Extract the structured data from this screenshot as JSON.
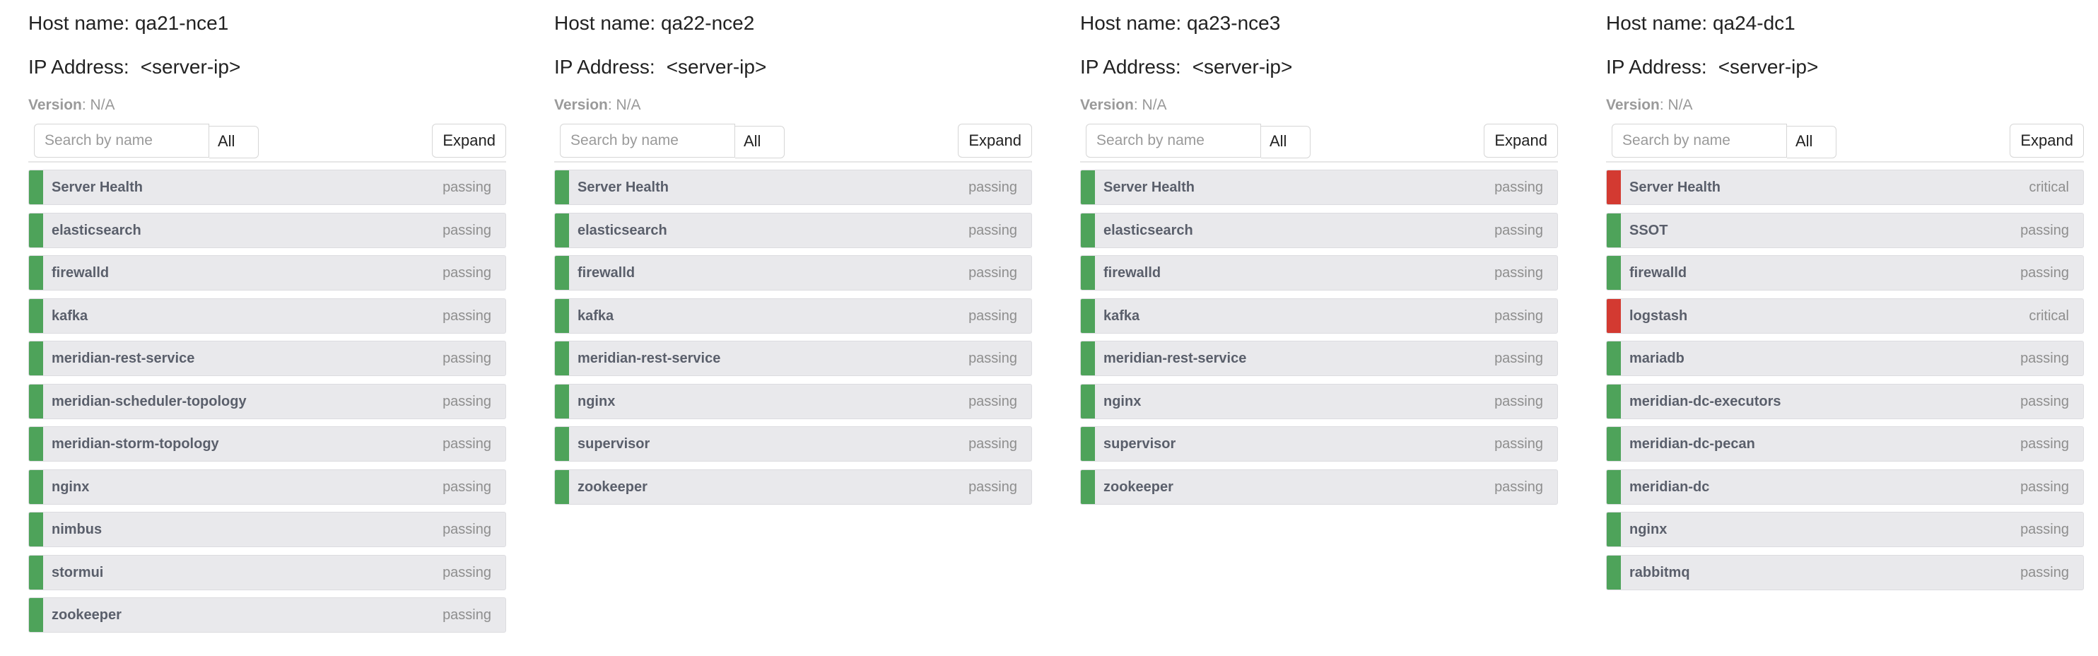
{
  "labels": {
    "host_name_prefix": "Host name:",
    "ip_prefix": "IP Address:",
    "version_prefix": "Version",
    "search_placeholder": "Search by name",
    "filter_value": "All",
    "expand_label": "Expand"
  },
  "colors": {
    "passing": "#4ea35a",
    "critical": "#d33a31"
  },
  "hosts": [
    {
      "name": "qa21-nce1",
      "ip": "<server-ip>",
      "version": ": N/A",
      "checks": [
        {
          "name": "Server Health",
          "status": "passing"
        },
        {
          "name": "elasticsearch",
          "status": "passing"
        },
        {
          "name": "firewalld",
          "status": "passing"
        },
        {
          "name": "kafka",
          "status": "passing"
        },
        {
          "name": "meridian-rest-service",
          "status": "passing"
        },
        {
          "name": "meridian-scheduler-topology",
          "status": "passing"
        },
        {
          "name": "meridian-storm-topology",
          "status": "passing"
        },
        {
          "name": "nginx",
          "status": "passing"
        },
        {
          "name": "nimbus",
          "status": "passing"
        },
        {
          "name": "stormui",
          "status": "passing"
        },
        {
          "name": "zookeeper",
          "status": "passing"
        }
      ]
    },
    {
      "name": "qa22-nce2",
      "ip": "<server-ip>",
      "version": ": N/A",
      "checks": [
        {
          "name": "Server Health",
          "status": "passing"
        },
        {
          "name": "elasticsearch",
          "status": "passing"
        },
        {
          "name": "firewalld",
          "status": "passing"
        },
        {
          "name": "kafka",
          "status": "passing"
        },
        {
          "name": "meridian-rest-service",
          "status": "passing"
        },
        {
          "name": "nginx",
          "status": "passing"
        },
        {
          "name": "supervisor",
          "status": "passing"
        },
        {
          "name": "zookeeper",
          "status": "passing"
        }
      ]
    },
    {
      "name": "qa23-nce3",
      "ip": "<server-ip>",
      "version": ": N/A",
      "checks": [
        {
          "name": "Server Health",
          "status": "passing"
        },
        {
          "name": "elasticsearch",
          "status": "passing"
        },
        {
          "name": "firewalld",
          "status": "passing"
        },
        {
          "name": "kafka",
          "status": "passing"
        },
        {
          "name": "meridian-rest-service",
          "status": "passing"
        },
        {
          "name": "nginx",
          "status": "passing"
        },
        {
          "name": "supervisor",
          "status": "passing"
        },
        {
          "name": "zookeeper",
          "status": "passing"
        }
      ]
    },
    {
      "name": "qa24-dc1",
      "ip": "<server-ip>",
      "version": ": N/A",
      "checks": [
        {
          "name": "Server Health",
          "status": "critical"
        },
        {
          "name": "SSOT",
          "status": "passing"
        },
        {
          "name": "firewalld",
          "status": "passing"
        },
        {
          "name": "logstash",
          "status": "critical"
        },
        {
          "name": "mariadb",
          "status": "passing"
        },
        {
          "name": "meridian-dc-executors",
          "status": "passing"
        },
        {
          "name": "meridian-dc-pecan",
          "status": "passing"
        },
        {
          "name": "meridian-dc",
          "status": "passing"
        },
        {
          "name": "nginx",
          "status": "passing"
        },
        {
          "name": "rabbitmq",
          "status": "passing"
        }
      ]
    }
  ]
}
